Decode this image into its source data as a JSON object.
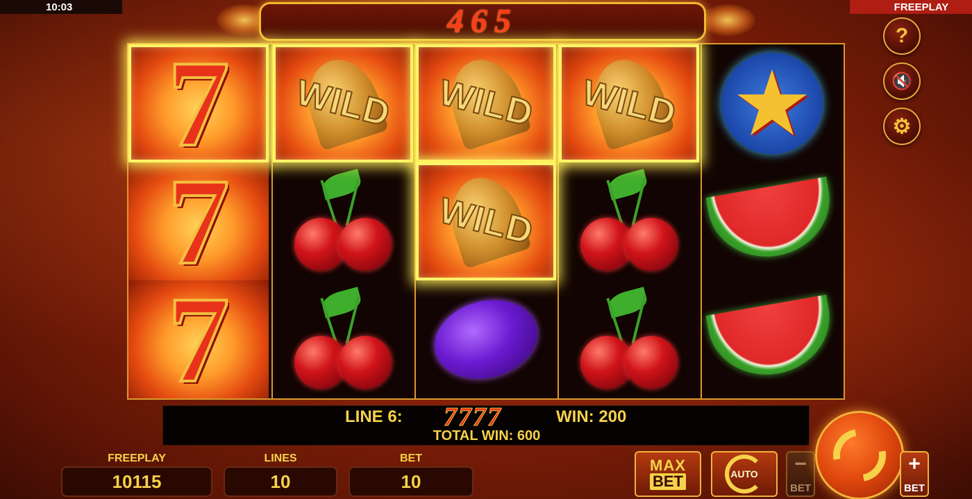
{
  "status_bar": {
    "clock": "10:03",
    "mode": "FREEPLAY"
  },
  "jackpot": {
    "value": "465"
  },
  "side_buttons": {
    "help": "?",
    "sound": "🔇",
    "settings": "⚙"
  },
  "reels": [
    [
      "seven",
      "seven",
      "seven"
    ],
    [
      "wild",
      "cherry",
      "cherry"
    ],
    [
      "wild",
      "wild",
      "plum"
    ],
    [
      "wild",
      "cherry",
      "cherry"
    ],
    [
      "star",
      "watermelon",
      "watermelon"
    ]
  ],
  "symbols": {
    "seven": "7",
    "wild": "WILD"
  },
  "highlighted_cells": [
    "0-0",
    "1-0",
    "2-0",
    "2-1",
    "3-0"
  ],
  "win_info": {
    "line_label": "LINE 6:",
    "line_symbols": "7777",
    "win_label": "WIN: 200",
    "total_win": "TOTAL WIN: 600"
  },
  "stats": {
    "freeplay_label": "FREEPLAY",
    "freeplay_value": "10115",
    "lines_label": "LINES",
    "lines_value": "10",
    "bet_label": "BET",
    "bet_value": "10"
  },
  "controls": {
    "max_bet_top": "MAX",
    "max_bet_bottom": "BET",
    "auto_label": "AUTO",
    "bet_minus_symbol": "−",
    "bet_minus_label": "BET",
    "bet_plus_symbol": "+",
    "bet_plus_label": "BET"
  },
  "colors": {
    "accent_gold": "#f6d24a",
    "frame": "#d99a2a",
    "highlight": "#fff46a",
    "freeplay_tag": "#b01d12"
  }
}
